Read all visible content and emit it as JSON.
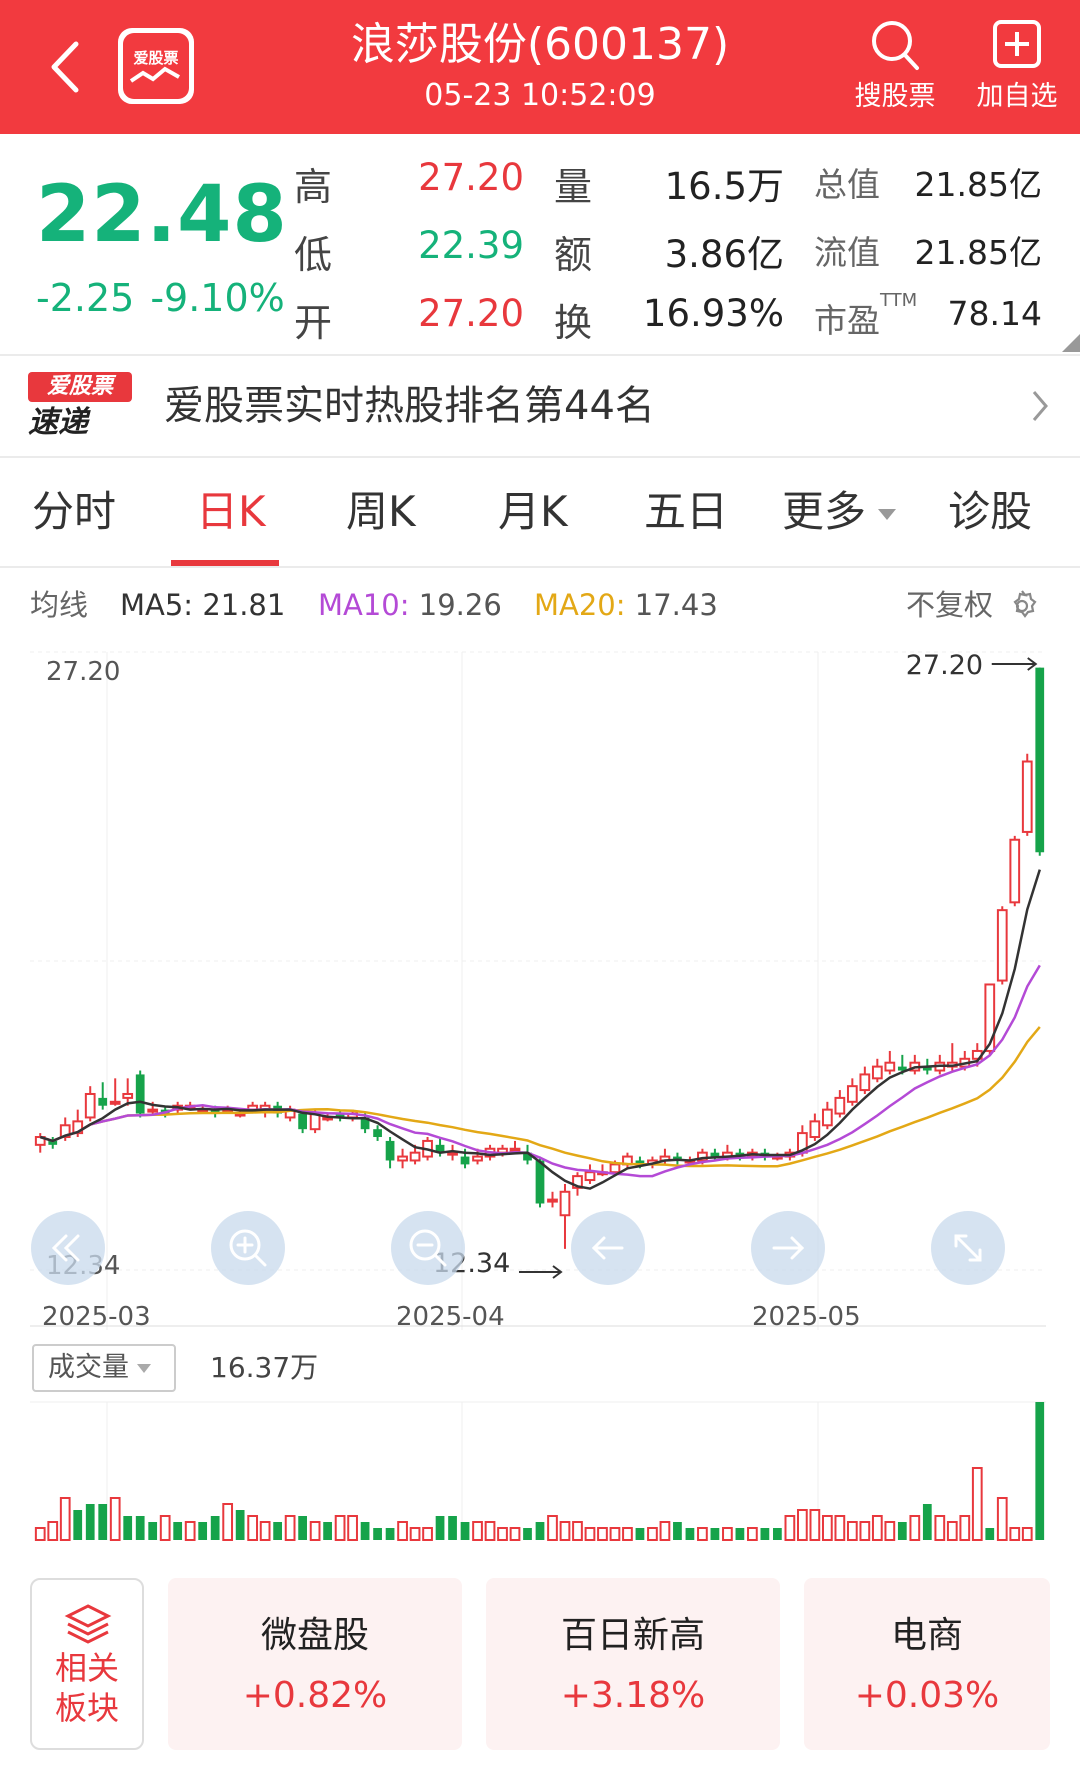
{
  "header": {
    "app_logo_text": "爱股票",
    "title": "浪莎股份(600137)",
    "datetime": "05-23 10:52:09",
    "search_label": "搜股票",
    "add_label": "加自选"
  },
  "quote": {
    "price": "22.48",
    "change": "-2.25",
    "change_pct": "-9.10%",
    "high_label": "高",
    "high": "27.20",
    "low_label": "低",
    "low": "22.39",
    "open_label": "开",
    "open": "27.20",
    "volume_label": "量",
    "volume": "16.5万",
    "amount_label": "额",
    "amount": "3.86亿",
    "turnover_label": "换",
    "turnover": "16.93%",
    "mktcap_label": "总值",
    "mktcap": "21.85亿",
    "float_label": "流值",
    "float": "21.85亿",
    "pe_label": "市盈",
    "pe_sup": "TTM",
    "pe": "78.14"
  },
  "news": {
    "logo_top": "爱股票",
    "logo_bottom": "速递",
    "text": "爱股票实时热股排名第44名"
  },
  "tabs": [
    {
      "label": "分时"
    },
    {
      "label": "日K"
    },
    {
      "label": "周K"
    },
    {
      "label": "月K"
    },
    {
      "label": "五日"
    },
    {
      "label": "更多"
    },
    {
      "label": "诊股"
    }
  ],
  "ma": {
    "label": "均线",
    "ma5_label": "MA5:",
    "ma5": "21.81",
    "ma10_label": "MA10:",
    "ma10": "19.26",
    "ma20_label": "MA20:",
    "ma20": "17.43",
    "adjust": "不复权",
    "colors": {
      "ma5": "#333333",
      "ma10": "#b44ad6",
      "ma20": "#e3a816"
    }
  },
  "chart_data": {
    "type": "candlestick",
    "y_max_label": "27.20",
    "y_min_label": "12.34",
    "high_marker": "27.20",
    "low_marker": "12.34",
    "x_labels": [
      "2025-03",
      "2025-04",
      "2025-05"
    ],
    "ylim": [
      11.8,
      27.6
    ],
    "candles": [
      [
        15.0,
        15.2,
        14.8,
        15.3
      ],
      [
        15.1,
        15.0,
        14.9,
        15.2
      ],
      [
        15.2,
        15.5,
        15.1,
        15.7
      ],
      [
        15.3,
        15.6,
        15.2,
        15.9
      ],
      [
        15.7,
        16.3,
        15.6,
        16.5
      ],
      [
        16.2,
        16.0,
        15.9,
        16.6
      ],
      [
        16.1,
        16.1,
        16.0,
        16.7
      ],
      [
        16.2,
        16.3,
        16.0,
        16.7
      ],
      [
        16.8,
        15.8,
        15.7,
        16.9
      ],
      [
        15.9,
        15.9,
        15.8,
        16.1
      ],
      [
        15.9,
        15.8,
        15.7,
        16.0
      ],
      [
        15.9,
        16.0,
        15.8,
        16.1
      ],
      [
        16.0,
        16.0,
        15.9,
        16.1
      ],
      [
        15.9,
        15.9,
        15.8,
        16.0
      ],
      [
        15.9,
        15.8,
        15.7,
        16.0
      ],
      [
        15.9,
        15.9,
        15.8,
        16.0
      ],
      [
        15.8,
        15.8,
        15.7,
        15.9
      ],
      [
        15.9,
        16.0,
        15.8,
        16.1
      ],
      [
        15.9,
        16.0,
        15.7,
        16.1
      ],
      [
        16.0,
        15.8,
        15.7,
        16.1
      ],
      [
        15.7,
        15.9,
        15.6,
        16.0
      ],
      [
        15.8,
        15.4,
        15.3,
        15.9
      ],
      [
        15.4,
        15.8,
        15.3,
        15.9
      ],
      [
        15.7,
        15.7,
        15.6,
        15.8
      ],
      [
        15.8,
        15.7,
        15.6,
        15.9
      ],
      [
        15.7,
        15.8,
        15.6,
        15.9
      ],
      [
        15.7,
        15.4,
        15.3,
        15.8
      ],
      [
        15.4,
        15.2,
        15.1,
        15.5
      ],
      [
        15.1,
        14.6,
        14.4,
        15.2
      ],
      [
        14.6,
        14.7,
        14.4,
        14.9
      ],
      [
        14.6,
        14.8,
        14.5,
        15.0
      ],
      [
        14.7,
        15.1,
        14.6,
        15.2
      ],
      [
        15.0,
        14.8,
        14.7,
        15.2
      ],
      [
        14.8,
        14.8,
        14.6,
        15.0
      ],
      [
        14.7,
        14.5,
        14.4,
        14.9
      ],
      [
        14.6,
        14.7,
        14.5,
        14.9
      ],
      [
        14.7,
        14.9,
        14.6,
        15.0
      ],
      [
        14.8,
        14.9,
        14.7,
        15.0
      ],
      [
        14.9,
        14.9,
        14.8,
        15.1
      ],
      [
        14.8,
        14.6,
        14.5,
        15.0
      ],
      [
        14.6,
        13.5,
        13.4,
        14.7
      ],
      [
        13.6,
        13.6,
        13.4,
        13.8
      ],
      [
        13.2,
        13.8,
        12.34,
        14.0
      ],
      [
        13.9,
        14.2,
        13.7,
        14.3
      ],
      [
        14.1,
        14.3,
        14.0,
        14.5
      ],
      [
        14.3,
        14.3,
        14.2,
        14.5
      ],
      [
        14.3,
        14.5,
        14.2,
        14.6
      ],
      [
        14.5,
        14.7,
        14.4,
        14.8
      ],
      [
        14.6,
        14.5,
        14.4,
        14.7
      ],
      [
        14.5,
        14.6,
        14.4,
        14.7
      ],
      [
        14.6,
        14.7,
        14.5,
        14.9
      ],
      [
        14.7,
        14.6,
        14.5,
        14.8
      ],
      [
        14.6,
        14.6,
        14.5,
        14.7
      ],
      [
        14.6,
        14.8,
        14.5,
        14.9
      ],
      [
        14.8,
        14.7,
        14.6,
        14.9
      ],
      [
        14.7,
        14.8,
        14.6,
        15.0
      ],
      [
        14.8,
        14.7,
        14.6,
        14.9
      ],
      [
        14.7,
        14.8,
        14.6,
        14.9
      ],
      [
        14.8,
        14.7,
        14.6,
        14.9
      ],
      [
        14.7,
        14.7,
        14.6,
        14.8
      ],
      [
        14.7,
        14.8,
        14.6,
        14.9
      ],
      [
        14.8,
        15.3,
        14.7,
        15.5
      ],
      [
        15.2,
        15.6,
        15.1,
        15.8
      ],
      [
        15.5,
        15.9,
        15.4,
        16.1
      ],
      [
        15.8,
        16.2,
        15.7,
        16.4
      ],
      [
        16.1,
        16.5,
        16.0,
        16.7
      ],
      [
        16.4,
        16.8,
        16.3,
        17.0
      ],
      [
        16.7,
        17.0,
        16.6,
        17.2
      ],
      [
        16.9,
        17.1,
        16.8,
        17.4
      ],
      [
        17.0,
        16.9,
        16.8,
        17.3
      ],
      [
        16.9,
        17.1,
        16.8,
        17.3
      ],
      [
        17.0,
        16.9,
        16.8,
        17.2
      ],
      [
        16.9,
        17.1,
        16.8,
        17.3
      ],
      [
        17.0,
        17.1,
        16.9,
        17.6
      ],
      [
        17.0,
        17.2,
        16.9,
        17.4
      ],
      [
        17.2,
        17.4,
        17.0,
        17.6
      ],
      [
        17.4,
        19.1,
        17.3,
        19.1
      ],
      [
        19.2,
        21.0,
        19.1,
        21.1
      ],
      [
        21.2,
        22.8,
        21.1,
        22.9
      ],
      [
        23.0,
        24.8,
        22.9,
        25.0
      ],
      [
        27.2,
        22.48,
        22.39,
        27.2
      ]
    ],
    "volume_label": "成交量",
    "volume_value": "16.37万",
    "volumes": [
      2,
      3,
      7,
      5,
      6,
      6,
      7,
      4,
      4,
      3,
      4,
      3,
      3,
      3,
      4,
      6,
      5,
      4,
      3,
      3,
      4,
      4,
      3,
      3,
      4,
      4,
      3,
      2,
      2,
      3,
      2,
      2,
      4,
      4,
      3,
      3,
      3,
      2,
      2,
      2,
      3,
      4,
      3,
      3,
      2,
      2,
      2,
      2,
      2,
      2,
      3,
      3,
      2,
      2,
      2,
      2,
      2,
      2,
      2,
      2,
      4,
      5,
      5,
      4,
      4,
      3,
      3,
      4,
      3,
      3,
      4,
      6,
      4,
      3,
      4,
      12,
      2,
      7,
      2,
      2,
      23
    ],
    "volume_up": [
      true,
      true,
      true,
      false,
      false,
      false,
      true,
      false,
      false,
      false,
      true,
      false,
      true,
      false,
      false,
      true,
      false,
      true,
      true,
      false,
      true,
      false,
      true,
      false,
      true,
      true,
      false,
      false,
      false,
      true,
      true,
      true,
      false,
      false,
      false,
      true,
      true,
      true,
      true,
      false,
      false,
      true,
      true,
      true,
      true,
      true,
      true,
      true,
      false,
      true,
      true,
      false,
      false,
      true,
      false,
      true,
      false,
      true,
      false,
      false,
      true,
      true,
      true,
      true,
      true,
      true,
      true,
      true,
      true,
      false,
      true,
      false,
      true,
      true,
      true,
      true,
      false,
      true,
      true,
      true,
      false
    ]
  },
  "sectors": {
    "related_label": "相关板块",
    "items": [
      {
        "name": "微盘股",
        "change": "+0.82%"
      },
      {
        "name": "百日新高",
        "change": "+3.18%"
      },
      {
        "name": "电商",
        "change": "+0.03%"
      }
    ]
  }
}
